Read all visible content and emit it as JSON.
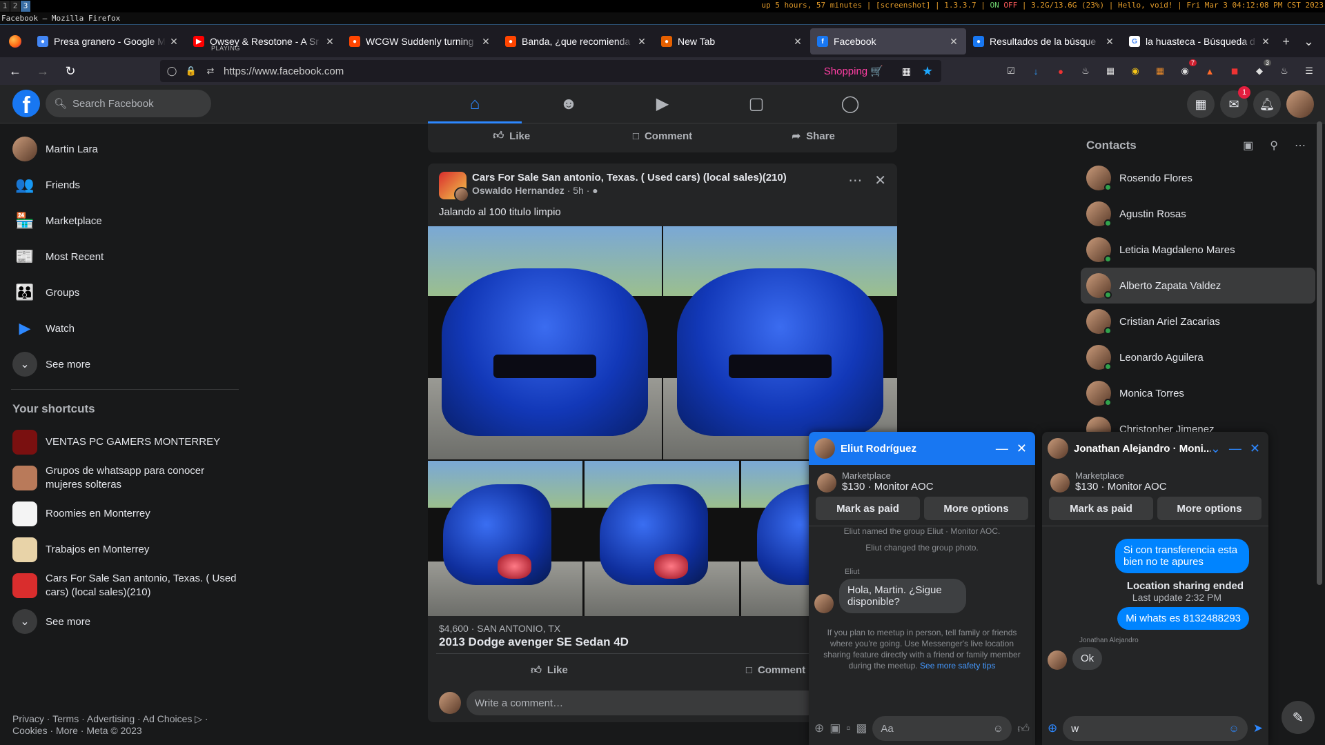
{
  "system": {
    "workspaces": [
      "1",
      "2",
      "3"
    ],
    "active_workspace": "3",
    "status_left": "up 5 hours, 57 minutes | [screenshot] | 1.3.3.7 |",
    "status_on": "ON",
    "status_off": "OFF",
    "status_right": "| 3.2G/13.6G (23%) | Hello, void! | Fri Mar  3 04:12:08 PM CST 2023",
    "window_title": "Facebook — Mozilla Firefox"
  },
  "browser": {
    "tabs": [
      {
        "label": "Presa granero - Google M",
        "fav_color": "#4285f4",
        "fav": "●"
      },
      {
        "label": "Owsey & Resotone - A Sr",
        "sub": "PLAYING",
        "fav_color": "#ff0000",
        "fav": "▶"
      },
      {
        "label": "WCGW Suddenly turning",
        "fav_color": "#ff4500",
        "fav": "●"
      },
      {
        "label": "Banda, ¿que recomienda",
        "fav_color": "#ff4500",
        "fav": "●"
      },
      {
        "label": "New Tab",
        "fav_color": "#e66000",
        "fav": "●"
      },
      {
        "label": "Facebook",
        "fav_color": "#1877f2",
        "fav": "f",
        "active": true
      },
      {
        "label": "Resultados de la búsque",
        "fav_color": "#1877f2",
        "fav": "●"
      },
      {
        "label": "la huasteca - Búsqueda d",
        "fav_color": "#ffffff",
        "fav": "G"
      }
    ],
    "new_tab": "+",
    "tab_list": "⌄",
    "url": "https://www.facebook.com",
    "shopping_label": "Shopping 🛒",
    "ext_badges": {
      "e4": "7",
      "e8": "3"
    }
  },
  "fb": {
    "logo": "f",
    "search_placeholder": "Search Facebook",
    "messenger_badge": "1",
    "left_nav": [
      {
        "label": "Martin Lara",
        "kind": "avatar"
      },
      {
        "label": "Friends",
        "icon": "👥",
        "color": "#2d88ff"
      },
      {
        "label": "Marketplace",
        "icon": "🏪",
        "color": "#2d88ff"
      },
      {
        "label": "Most Recent",
        "icon": "📰",
        "color": "#2d88ff"
      },
      {
        "label": "Groups",
        "icon": "👪",
        "color": "#2d88ff"
      },
      {
        "label": "Watch",
        "icon": "▶",
        "color": "#2d88ff"
      },
      {
        "label": "See more",
        "kind": "more"
      }
    ],
    "shortcuts_title": "Your shortcuts",
    "shortcuts": [
      {
        "label": "VENTAS PC GAMERS MONTERREY",
        "color": "#7a1010"
      },
      {
        "label": "Grupos de whatsapp para conocer mujeres solteras",
        "color": "#b97a5a"
      },
      {
        "label": "Roomies en Monterrey",
        "color": "#f4f4f4"
      },
      {
        "label": "Trabajos en Monterrey",
        "color": "#e8d3a8"
      },
      {
        "label": "Cars For Sale San antonio, Texas. ( Used cars) (local sales)(210)",
        "color": "#d92d2d"
      }
    ],
    "shortcuts_more": "See more",
    "footer": "Privacy · Terms · Advertising · Ad Choices ▷ · Cookies · More · Meta © 2023"
  },
  "feed": {
    "like": "Like",
    "comment": "Comment",
    "share": "Share",
    "post": {
      "group": "Cars For Sale San antonio, Texas. ( Used cars) (local sales)(210)",
      "author": "Oswaldo Hernandez",
      "time": "5h",
      "text": "Jalando al 100 titulo limpio",
      "price": "$4,600 · SAN ANTONIO, TX",
      "title": "2013 Dodge avenger SE Sedan 4D",
      "comment_placeholder": "Write a comment…"
    }
  },
  "contacts": {
    "title": "Contacts",
    "list": [
      {
        "name": "Rosendo Flores",
        "online": true
      },
      {
        "name": "Agustin Rosas",
        "online": true
      },
      {
        "name": "Leticia Magdaleno Mares",
        "online": true
      },
      {
        "name": "Alberto Zapata Valdez",
        "online": true,
        "hover": true
      },
      {
        "name": "Cristian Ariel Zacarias",
        "online": true
      },
      {
        "name": "Leonardo Aguilera",
        "online": true
      },
      {
        "name": "Monica Torres",
        "online": true
      },
      {
        "name": "Christopher Jimenez",
        "online": false
      }
    ]
  },
  "chat1": {
    "name": "Eliut Rodríguez",
    "mkt_label": "Marketplace",
    "mkt_price": "$130 · Monitor AOC",
    "btn_paid": "Mark as paid",
    "btn_more": "More options",
    "sys1": "Eliut named the group Eliut · Monitor AOC.",
    "sys2": "Eliut changed the group photo.",
    "sender": "Eliut",
    "msg": "Hola, Martin. ¿Sigue disponible?",
    "safety": "If you plan to meetup in person, tell family or friends where you're going. Use Messenger's live location sharing feature directly with a friend or family member during the meetup.",
    "safety_link": "See more safety tips",
    "input_placeholder": "Aa"
  },
  "chat2": {
    "name": "Jonathan Alejandro · Moni...",
    "mkt_label": "Marketplace",
    "mkt_price": "$130 · Monitor AOC",
    "btn_paid": "Mark as paid",
    "btn_more": "More options",
    "out1": "Si con transferencia esta bien no te apures",
    "loc_title": "Location sharing ended",
    "loc_sub": "Last update 2:32 PM",
    "out2": "Mi whats es 8132488293",
    "sender": "Jonathan Alejandro",
    "reply": "Ok",
    "input_value": "w"
  }
}
